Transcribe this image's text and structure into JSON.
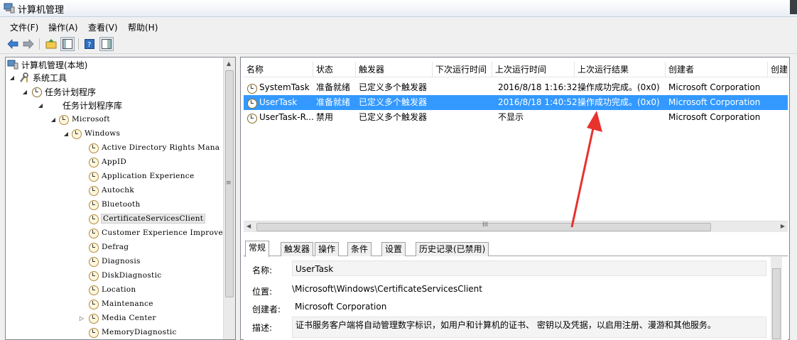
{
  "window": {
    "title": "计算机管理"
  },
  "menu": [
    "文件(F)",
    "操作(A)",
    "查看(V)",
    "帮助(H)"
  ],
  "toolbar": {
    "buttons": [
      "back-icon",
      "forward-icon",
      "up-folder-icon",
      "show-hide-tree-icon",
      "help-icon",
      "properties-icon"
    ]
  },
  "tree": {
    "items": [
      {
        "label": "计算机管理(本地)",
        "icon": "computer-icon"
      },
      {
        "label": "系统工具",
        "icon": "tools-icon",
        "arrow": "◢"
      },
      {
        "label": "任务计划程序",
        "icon": "clock-icon",
        "arrow": "◢"
      },
      {
        "label": "任务计划程序库",
        "icon": "",
        "arrow": "◢"
      },
      {
        "label": "Microsoft",
        "icon": "folder-clock-icon",
        "arrow": "◢"
      },
      {
        "label": "Windows",
        "icon": "folder-clock-icon",
        "arrow": "◢"
      },
      {
        "label": "Active Directory Rights Mana",
        "icon": "folder-clock-icon"
      },
      {
        "label": "AppID",
        "icon": "folder-clock-icon"
      },
      {
        "label": "Application Experience",
        "icon": "folder-clock-icon"
      },
      {
        "label": "Autochk",
        "icon": "folder-clock-icon"
      },
      {
        "label": "Bluetooth",
        "icon": "folder-clock-icon"
      },
      {
        "label": "CertificateServicesClient",
        "icon": "folder-clock-icon",
        "selected": true
      },
      {
        "label": "Customer Experience Improvem",
        "icon": "folder-clock-icon"
      },
      {
        "label": "Defrag",
        "icon": "folder-clock-icon"
      },
      {
        "label": "Diagnosis",
        "icon": "folder-clock-icon"
      },
      {
        "label": "DiskDiagnostic",
        "icon": "folder-clock-icon"
      },
      {
        "label": "Location",
        "icon": "folder-clock-icon"
      },
      {
        "label": "Maintenance",
        "icon": "folder-clock-icon"
      },
      {
        "label": "Media Center",
        "icon": "folder-clock-icon",
        "arrow": "▷"
      },
      {
        "label": "MemoryDiagnostic",
        "icon": "folder-clock-icon"
      }
    ]
  },
  "task_list": {
    "columns": [
      "名称",
      "状态",
      "触发器",
      "下次运行时间",
      "上次运行时间",
      "上次运行结果",
      "创建者",
      "创建"
    ],
    "rows": [
      {
        "name": "SystemTask",
        "status": "准备就绪",
        "trigger": "已定义多个触发器",
        "next_run": "",
        "last_run": "2016/8/18 1:16:32",
        "last_result": "操作成功完成。(0x0)",
        "author": "Microsoft Corporation"
      },
      {
        "name": "UserTask",
        "status": "准备就绪",
        "trigger": "已定义多个触发器",
        "next_run": "",
        "last_run": "2016/8/18 1:40:52",
        "last_result": "操作成功完成。(0x0)",
        "author": "Microsoft Corporation",
        "selected": true
      },
      {
        "name": "UserTask-R...",
        "status": "禁用",
        "trigger": "已定义多个触发器",
        "next_run": "",
        "last_run": "不显示",
        "last_result": "",
        "author": "Microsoft Corporation"
      }
    ]
  },
  "detail_tabs": [
    "常规",
    "触发器",
    "操作",
    "条件",
    "设置",
    "历史记录(已禁用)"
  ],
  "details": {
    "name_label": "名称:",
    "name_value": "UserTask",
    "location_label": "位置:",
    "location_value": "\\Microsoft\\Windows\\CertificateServicesClient",
    "author_label": "创建者:",
    "author_value": "Microsoft Corporation",
    "desc_label": "描述:",
    "desc_value": "证书服务客户端将自动管理数字标识，如用户和计算机的证书、 密钥以及凭据，以启用注册、漫游和其他服务。"
  },
  "colors": {
    "selection": "#3399ff",
    "annotation_arrow": "#e8322e"
  }
}
